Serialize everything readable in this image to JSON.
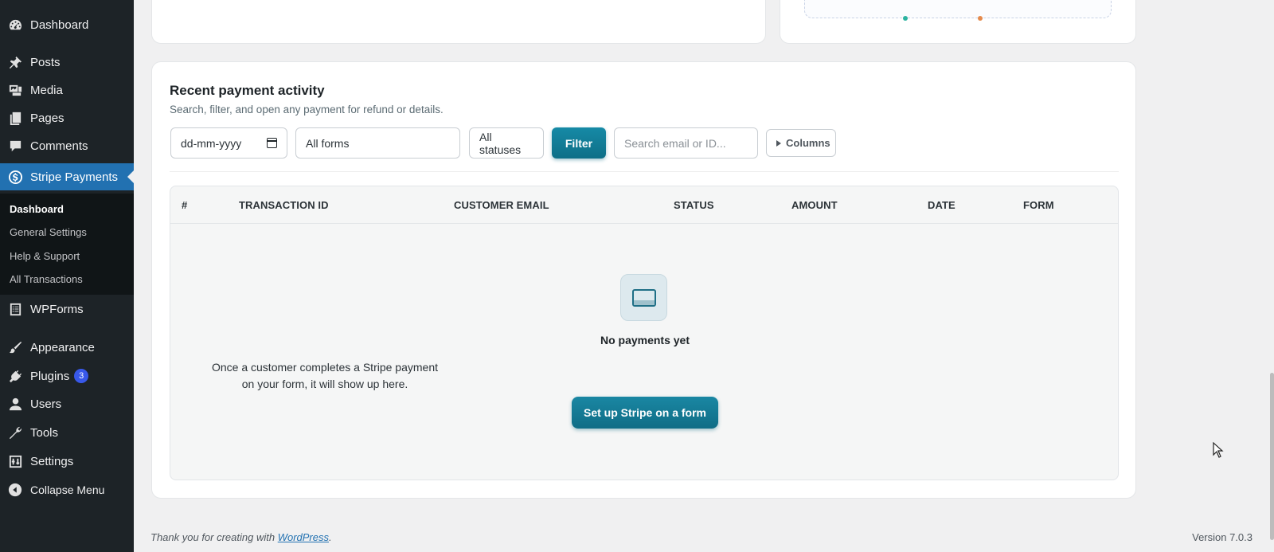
{
  "sidebar": {
    "items": [
      {
        "label": "Dashboard",
        "icon": "dashboard-icon"
      },
      {
        "label": "Posts",
        "icon": "pin-icon"
      },
      {
        "label": "Media",
        "icon": "media-icon"
      },
      {
        "label": "Pages",
        "icon": "pages-icon"
      },
      {
        "label": "Comments",
        "icon": "comment-icon"
      },
      {
        "label": "Stripe Payments",
        "icon": "dollar-icon"
      },
      {
        "label": "WPForms",
        "icon": "forms-icon"
      },
      {
        "label": "Appearance",
        "icon": "brush-icon"
      },
      {
        "label": "Plugins",
        "icon": "plugin-icon",
        "badge": "3"
      },
      {
        "label": "Users",
        "icon": "user-icon"
      },
      {
        "label": "Tools",
        "icon": "wrench-icon"
      },
      {
        "label": "Settings",
        "icon": "settings-icon"
      },
      {
        "label": "Collapse Menu",
        "icon": "collapse-icon"
      }
    ],
    "submenu": [
      "Dashboard",
      "General Settings",
      "Help & Support",
      "All Transactions"
    ]
  },
  "activity": {
    "title": "Recent payment activity",
    "subtitle": "Search, filter, and open any payment for refund or details.",
    "date_placeholder": "dd-mm-yyyy",
    "forms_selected": "All forms",
    "status_selected": "All statuses",
    "filter_label": "Filter",
    "search_placeholder": "Search email or ID...",
    "columns_label": "Columns"
  },
  "table": {
    "columns": [
      "#",
      "TRANSACTION ID",
      "CUSTOMER EMAIL",
      "STATUS",
      "AMOUNT",
      "DATE",
      "FORM"
    ]
  },
  "empty_state": {
    "icon": "credit-card-icon",
    "title": "No payments yet",
    "description": "Once a customer completes a Stripe payment on your form, it will show up here.",
    "button": "Set up Stripe on a form"
  },
  "footer": {
    "thanks_prefix": "Thank you for creating with ",
    "thanks_link": "WordPress",
    "thanks_suffix": ".",
    "version": "Version 7.0.3"
  },
  "colors": {
    "sidebar_bg": "#1d2327",
    "active_menu": "#2271b1",
    "accent_teal": "#0f6d86",
    "badge": "#3858e9"
  }
}
